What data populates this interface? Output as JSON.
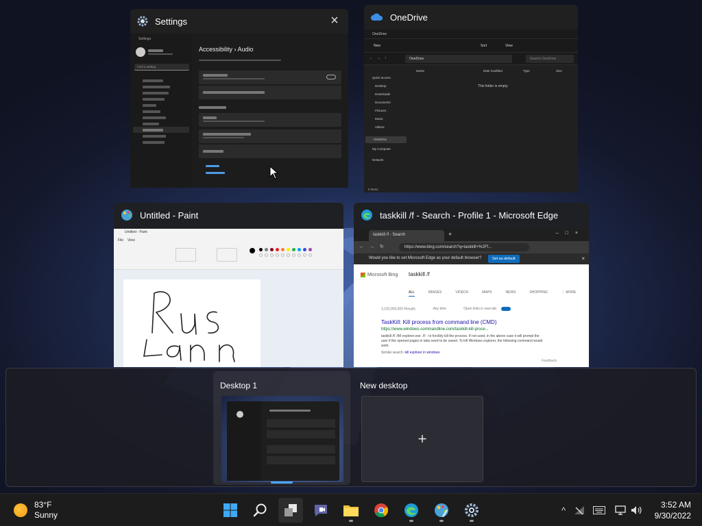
{
  "windows": {
    "settings": {
      "title": "Settings",
      "breadcrumb": "Accessibility  ›  Audio",
      "app_name": "Settings",
      "search_placeholder": "Find a setting"
    },
    "onedrive": {
      "title": "OneDrive",
      "tab_title": "OneDrive",
      "new_label": "New",
      "sort_label": "Sort",
      "view_label": "View",
      "search_placeholder": "Search OneDrive",
      "breadcrumb": "OneDrive",
      "columns": [
        "Name",
        "Date modified",
        "Type",
        "Size"
      ],
      "empty_message": "This folder is empty.",
      "nav": [
        "Quick access",
        "Desktop",
        "Downloads",
        "Documents",
        "Pictures",
        "Music",
        "Videos",
        "OneDrive",
        "My Computer",
        "Network"
      ],
      "status": "0 items"
    },
    "paint": {
      "title": "Untitled - Paint",
      "window_title": "Untitled - Paint",
      "menu": [
        "File",
        "View"
      ]
    },
    "edge": {
      "title": "taskkill /f - Search - Profile 1 - Microsoft Edge",
      "tab_title": "taskkill /f - Search",
      "url": "https://www.bing.com/search?q=taskkill+%2Ff...",
      "default_prompt": "Would you like to set Microsoft Edge as your default browser?",
      "set_default": "Set as default",
      "bing_brand": "Microsoft Bing",
      "query": "taskkill /f",
      "nav": [
        "ALL",
        "IMAGES",
        "VIDEOS",
        "MAPS",
        "NEWS",
        "SHOPPING",
        "⋮ MORE"
      ],
      "results_count": "3,150,000,000 Results",
      "any_time": "Any time",
      "open_links": "Open links in new tab",
      "result_title": "TaskKill: Kill process from command line (CMD)",
      "result_url": "https://www.windows-commandline.com/taskkill-kill-proce...",
      "result_snippet": "taskkill /F /IM explorer.exe ./F : to forcibly kill the process. If not used, in the above case it will prompt the user if the opened pages in tabs need to be saved. To kill Windows explorer, the following command would work.",
      "similar_label": "Similar search:",
      "similar_link": "kill explorer in windows",
      "feedback": "Feedback"
    }
  },
  "desktops": {
    "items": [
      {
        "label": "Desktop 1"
      },
      {
        "label": "New desktop"
      }
    ],
    "new_symbol": "+"
  },
  "taskbar": {
    "weather_temp": "83°F",
    "weather_desc": "Sunny",
    "apps": [
      "windows-start",
      "search",
      "task-view",
      "teams-chat",
      "file-explorer",
      "chrome",
      "edge",
      "paint",
      "settings"
    ],
    "time": "3:52 AM",
    "date": "9/30/2022"
  },
  "colors": {
    "accent": "#4ca8ff",
    "bing_link": "#1a0dab"
  }
}
